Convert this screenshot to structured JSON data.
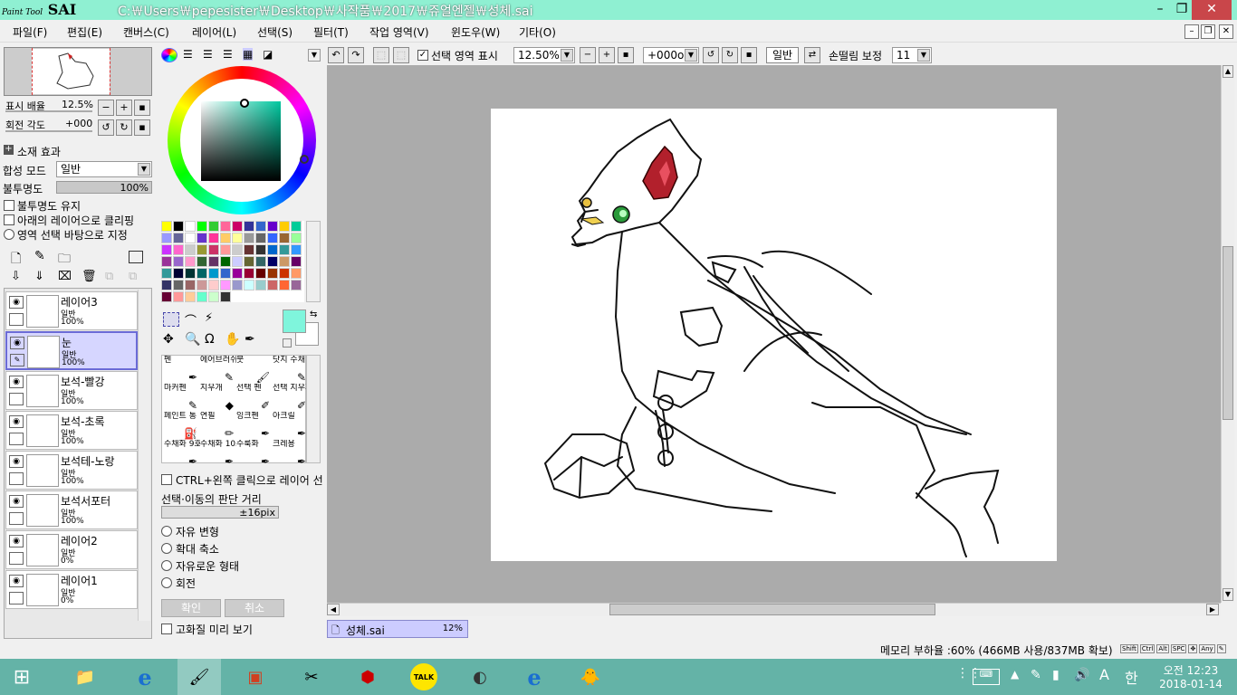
{
  "app": {
    "logo_main": "SAI",
    "logo_small": "Paint Tool",
    "title": "C:￦Users￦pepesister￦Desktop￦사작품￦2017￦쥬얼엔젤￦성체.sai"
  },
  "menu": [
    "파일(F)",
    "편집(E)",
    "캔버스(C)",
    "레이어(L)",
    "선택(S)",
    "필터(T)",
    "작업 영역(V)",
    "윈도우(W)",
    "기타(O)"
  ],
  "navigator": {
    "zoom_label": "표시 배율",
    "zoom_value": "12.5%",
    "rotate_label": "회전 각도",
    "rotate_value": "+000"
  },
  "layer_props": {
    "effects_label": "소재 효과",
    "blend_label": "합성 모드",
    "blend_value": "일반",
    "opacity_label": "불투명도",
    "opacity_value": "100%",
    "opacity_fraction": 1.0,
    "keep_opacity": "불투명도 유지",
    "clip_lower": "아래의 레이어으로 클리핑",
    "selection_source": "영역 선택 바탕으로 지정"
  },
  "layers": [
    {
      "name": "레이어3",
      "mode": "일반",
      "opacity": "100%",
      "selected": false
    },
    {
      "name": "눈",
      "mode": "일반",
      "opacity": "100%",
      "selected": true
    },
    {
      "name": "보석-빨강",
      "mode": "일반",
      "opacity": "100%",
      "selected": false
    },
    {
      "name": "보석-초록",
      "mode": "일반",
      "opacity": "100%",
      "selected": false
    },
    {
      "name": "보석테-노랑",
      "mode": "일반",
      "opacity": "100%",
      "selected": false
    },
    {
      "name": "보석서포터",
      "mode": "일반",
      "opacity": "100%",
      "selected": false
    },
    {
      "name": "레이어2",
      "mode": "일반",
      "opacity": "0%",
      "selected": false
    },
    {
      "name": "레이어1",
      "mode": "일반",
      "opacity": "0%",
      "selected": false
    }
  ],
  "colors": {
    "current_fg": "#7ff5dc",
    "current_bg": "#ffffff",
    "accent": "#8ff0d2"
  },
  "swatches": [
    "#ffff00",
    "#000000",
    "#ffffff",
    "#00ff00",
    "#33cc33",
    "#ff6699",
    "#cc0066",
    "#333399",
    "#3366cc",
    "#6600cc",
    "#ffcc00",
    "#00cc99",
    "#9999ff",
    "#666699",
    "#ffffff",
    "#6633cc",
    "#ff3399",
    "#ffcc66",
    "#ffff99",
    "#999999",
    "#666666",
    "#3366ff",
    "#996633",
    "#99ff99",
    "#cc33ff",
    "#ff66cc",
    "#cccccc",
    "#999933",
    "#cc3366",
    "#ff9999",
    "#cccccc",
    "#663333",
    "#333333",
    "#0066cc",
    "#339999",
    "#3399ff",
    "#993399",
    "#9966cc",
    "#ff99cc",
    "#336633",
    "#663366",
    "#006600",
    "#ccccff",
    "#666633",
    "#336666",
    "#000066",
    "#cc9966",
    "#660066",
    "#339999",
    "#000033",
    "#003333",
    "#006666",
    "#0099cc",
    "#3366cc",
    "#990099",
    "#990033",
    "#660000",
    "#993300",
    "#cc3300",
    "#ff9966",
    "#333366",
    "#666666",
    "#996666",
    "#cc9999",
    "#ffcccc",
    "#ff99ff",
    "#9999cc",
    "#ccffff",
    "#99cccc",
    "#cc6666",
    "#ff6633",
    "#996699",
    "#660033",
    "#ff9999",
    "#ffcc99",
    "#66ffcc",
    "#ccffcc",
    "#333333"
  ],
  "tools": [
    {
      "name": "펜",
      "icon": "pen-icon"
    },
    {
      "name": "에어브러쉬",
      "icon": "airbrush-icon"
    },
    {
      "name": "붓",
      "icon": "brush-icon"
    },
    {
      "name": "닷지 수채",
      "icon": "watercolor-icon"
    },
    {
      "name": "마커펜",
      "icon": "marker-icon"
    },
    {
      "name": "지우개",
      "icon": "eraser-icon"
    },
    {
      "name": "선택 펜",
      "icon": "select-pen-icon"
    },
    {
      "name": "선택 지우개",
      "icon": "select-eraser-icon"
    },
    {
      "name": "페인트 통",
      "icon": "bucket-icon"
    },
    {
      "name": "연필",
      "icon": "pencil-icon"
    },
    {
      "name": "잉크펜",
      "icon": "ink-pen-icon"
    },
    {
      "name": "아크릴",
      "icon": "acrylic-icon"
    },
    {
      "name": "수채화 9호",
      "icon": "watercolor9-icon"
    },
    {
      "name": "수채화 10호",
      "icon": "watercolor10-icon"
    },
    {
      "name": "수룩화",
      "icon": "sumi-icon"
    },
    {
      "name": "크레용",
      "icon": "crayon-icon"
    }
  ],
  "tool_options": {
    "ctrl_click": "CTRL+왼쪽 클릭으로 레이어 선",
    "distance_label": "선택·이동의 판단 거리",
    "distance_value": "±16pix",
    "transform_options": [
      "자유 변형",
      "확대 축소",
      "자유로운 형태",
      "회전"
    ],
    "confirm": "확인",
    "cancel": "취소",
    "hq_preview": "고화질 미리 보기"
  },
  "toolbar": {
    "show_selection": "선택 영역 표시",
    "zoom": "12.50%",
    "rotation": "+000o",
    "blend": "일반",
    "stabilizer_label": "손떨림 보정",
    "stabilizer_value": "11"
  },
  "document_tab": {
    "name": "성체.sai",
    "zoom": "12%"
  },
  "status": {
    "memory": "메모리 부하율 :60% (466MB 사용/837MB 확보)",
    "keys": [
      "Shift",
      "Ctrl",
      "Alt",
      "SPC",
      "Any"
    ]
  },
  "taskbar": {
    "time": "오전 12:23",
    "date": "2018-01-14",
    "ime": "A",
    "lang": "한",
    "apps": [
      "file-explorer-icon",
      "internet-explorer-icon",
      "painttool-sai-icon",
      "powerpoint-icon",
      "app-icon",
      "app-icon",
      "kakaotalk-icon",
      "app-icon",
      "internet-explorer-icon",
      "app-icon"
    ],
    "kakaotalk_label": "TALK"
  }
}
